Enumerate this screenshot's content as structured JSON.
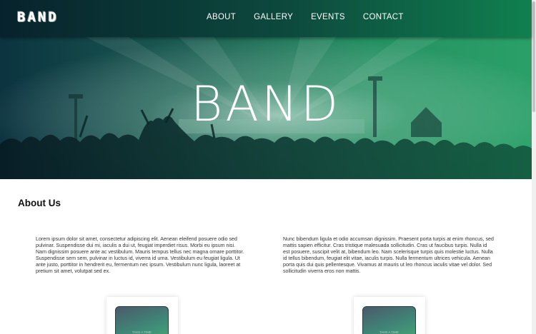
{
  "brand": {
    "logo_text": "BAND",
    "accent_dark": "#07222c",
    "accent_green": "#10804f"
  },
  "nav": {
    "items": [
      {
        "label": "ABOUT"
      },
      {
        "label": "GALLERY"
      },
      {
        "label": "EVENTS"
      },
      {
        "label": "CONTACT"
      }
    ]
  },
  "hero": {
    "title": "BAND",
    "image": "concert-crowd-photo"
  },
  "about": {
    "heading": "About Us",
    "left_text": "Lorem ipsum dolor sit amet, consectetur adipiscing elit. Aenean eleifend posuere odio sed pulvinar. Suspendisse dui mi, iaculis a dui ut, feugiat imperdiet risus. Morbi eu ipsum nisi. Nam dignissim posuere ante ac vestibulum. Mauris tempus tellus nec magna ornare porttitor. Suspendisse sem sem, pulvinar in luctus id, viverra id urna. Vestibulum eu feugiat ligula. Ut ante justo, porttitor in hendrerit eu, fermentum nec ipsum. Vestibulum nunc ligula, laoreet at pretium sit amet, volutpat sed ex.",
    "right_text": "Nunc bibendum ligula et odio accumsan dignissim. Praesent porta turpis at enim rhoncus, sed mattis sapien efficitur. Cras tristique malesuada sollicitudin. Cras ut faucibus turpis. Nulla id est posuere, suscipit velit at, bibendum leo. Nam scelerisque turpis quis molestie luctus. Nulla id tellus bibendum, feugiat elit vitae, iaculis turpis. Nulla fermentum ultrices vehicula. Aenean porta quis dui quis pellentesque. Vivamus at mauris ut leo rhoncus iaculis vitae vel dolor. Sed sollicitudin viverra eros non mattis."
  },
  "cards": [
    {
      "caption": "TAKE A TIME"
    },
    {
      "caption": "TAKE A TIME"
    }
  ]
}
